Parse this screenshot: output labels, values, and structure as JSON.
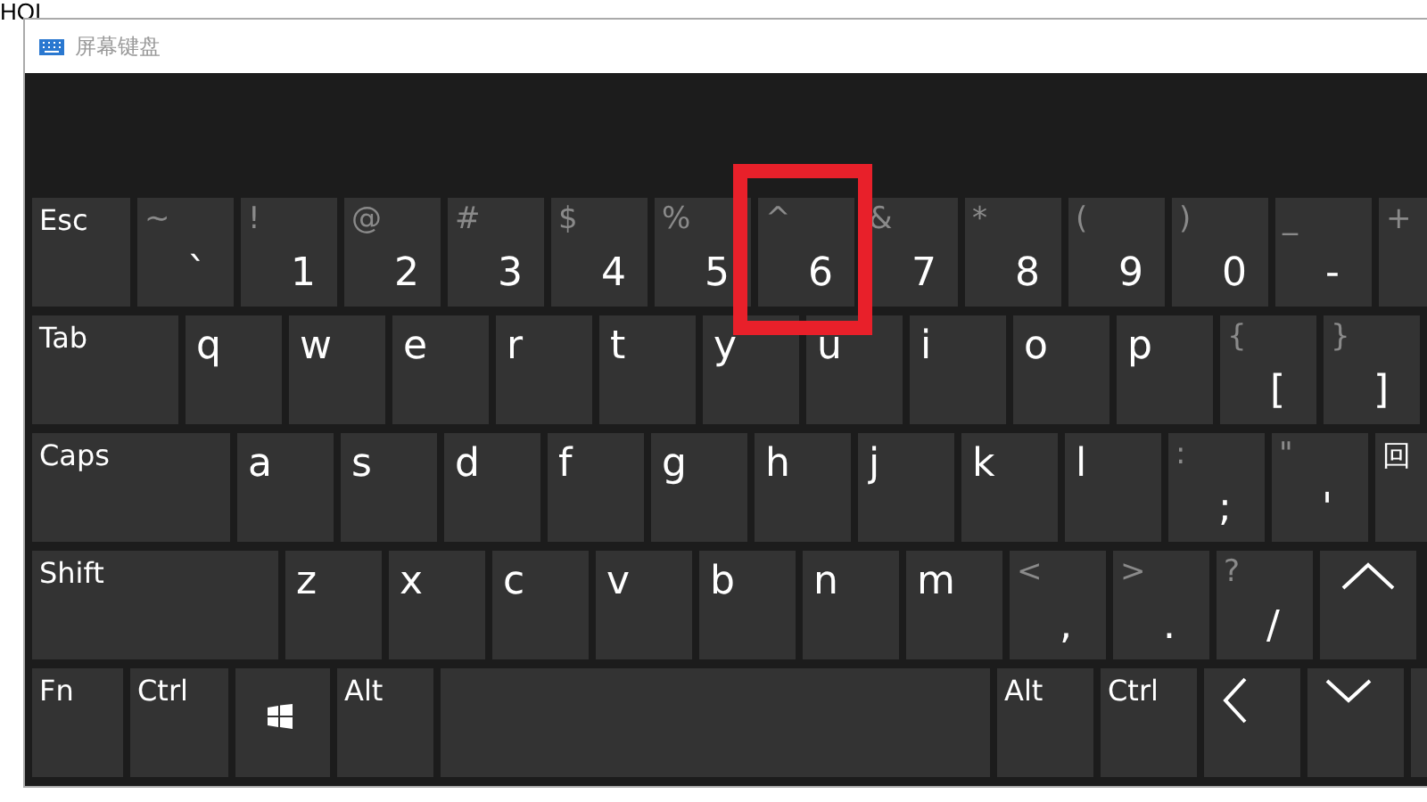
{
  "background_text": "HOI",
  "window": {
    "title": "屏幕键盘"
  },
  "rows": [
    {
      "keys": [
        {
          "kind": "mod",
          "label": "Esc",
          "highlighted": false
        },
        {
          "kind": "dual",
          "top": "~",
          "main": "`",
          "highlighted": false
        },
        {
          "kind": "dual",
          "top": "!",
          "main": "1",
          "highlighted": false
        },
        {
          "kind": "dual",
          "top": "@",
          "main": "2",
          "highlighted": false
        },
        {
          "kind": "dual",
          "top": "#",
          "main": "3",
          "highlighted": false
        },
        {
          "kind": "dual",
          "top": "$",
          "main": "4",
          "highlighted": false
        },
        {
          "kind": "dual",
          "top": "%",
          "main": "5",
          "highlighted": false
        },
        {
          "kind": "dual",
          "top": "^",
          "main": "6",
          "highlighted": true
        },
        {
          "kind": "dual",
          "top": "&",
          "main": "7",
          "highlighted": false
        },
        {
          "kind": "dual",
          "top": "*",
          "main": "8",
          "highlighted": false
        },
        {
          "kind": "dual",
          "top": "(",
          "main": "9",
          "highlighted": false
        },
        {
          "kind": "dual",
          "top": ")",
          "main": "0",
          "highlighted": false
        },
        {
          "kind": "dual",
          "top": "_",
          "main": "-",
          "highlighted": false
        },
        {
          "kind": "dual",
          "top": "+",
          "highlighted": false
        }
      ]
    },
    {
      "keys": [
        {
          "kind": "mod",
          "label": "Tab",
          "highlighted": false
        },
        {
          "kind": "char",
          "label": "q",
          "highlighted": false
        },
        {
          "kind": "char",
          "label": "w",
          "highlighted": false
        },
        {
          "kind": "char",
          "label": "e",
          "highlighted": false
        },
        {
          "kind": "char",
          "label": "r",
          "highlighted": false
        },
        {
          "kind": "char",
          "label": "t",
          "highlighted": false
        },
        {
          "kind": "char",
          "label": "y",
          "highlighted": false
        },
        {
          "kind": "char",
          "label": "u",
          "highlighted": false
        },
        {
          "kind": "char",
          "label": "i",
          "highlighted": false
        },
        {
          "kind": "char",
          "label": "o",
          "highlighted": false
        },
        {
          "kind": "char",
          "label": "p",
          "highlighted": false
        },
        {
          "kind": "dual",
          "top": "{",
          "main": "[",
          "highlighted": false
        },
        {
          "kind": "dual",
          "top": "}",
          "main": "]",
          "highlighted": false
        }
      ]
    },
    {
      "keys": [
        {
          "kind": "mod",
          "label": "Caps",
          "highlighted": false
        },
        {
          "kind": "char",
          "label": "a",
          "highlighted": false
        },
        {
          "kind": "char",
          "label": "s",
          "highlighted": false
        },
        {
          "kind": "char",
          "label": "d",
          "highlighted": false
        },
        {
          "kind": "char",
          "label": "f",
          "highlighted": false
        },
        {
          "kind": "char",
          "label": "g",
          "highlighted": false
        },
        {
          "kind": "char",
          "label": "h",
          "highlighted": false
        },
        {
          "kind": "char",
          "label": "j",
          "highlighted": false
        },
        {
          "kind": "char",
          "label": "k",
          "highlighted": false
        },
        {
          "kind": "char",
          "label": "l",
          "highlighted": false
        },
        {
          "kind": "dual",
          "top": ":",
          "main": ";",
          "highlighted": false
        },
        {
          "kind": "dual",
          "top": "\"",
          "main": "'",
          "highlighted": false
        },
        {
          "kind": "mod",
          "label": "回",
          "highlighted": false
        }
      ]
    },
    {
      "keys": [
        {
          "kind": "mod",
          "label": "Shift",
          "highlighted": false
        },
        {
          "kind": "char",
          "label": "z",
          "highlighted": false
        },
        {
          "kind": "char",
          "label": "x",
          "highlighted": false
        },
        {
          "kind": "char",
          "label": "c",
          "highlighted": false
        },
        {
          "kind": "char",
          "label": "v",
          "highlighted": false
        },
        {
          "kind": "char",
          "label": "b",
          "highlighted": false
        },
        {
          "kind": "char",
          "label": "n",
          "highlighted": false
        },
        {
          "kind": "char",
          "label": "m",
          "highlighted": false
        },
        {
          "kind": "dual",
          "top": "<",
          "main": ",",
          "highlighted": false
        },
        {
          "kind": "dual",
          "top": ">",
          "main": ".",
          "highlighted": false
        },
        {
          "kind": "dual",
          "top": "?",
          "main": "/",
          "highlighted": false
        },
        {
          "kind": "up",
          "highlighted": false
        }
      ]
    },
    {
      "keys": [
        {
          "kind": "mod",
          "label": "Fn",
          "highlighted": false
        },
        {
          "kind": "mod",
          "label": "Ctrl",
          "highlighted": false
        },
        {
          "kind": "win",
          "highlighted": false
        },
        {
          "kind": "mod",
          "label": "Alt",
          "highlighted": false
        },
        {
          "kind": "space",
          "highlighted": false
        },
        {
          "kind": "mod",
          "label": "Alt",
          "highlighted": false
        },
        {
          "kind": "mod",
          "label": "Ctrl",
          "highlighted": false
        },
        {
          "kind": "left",
          "highlighted": false
        },
        {
          "kind": "down",
          "highlighted": false
        },
        {
          "kind": "blank",
          "highlighted": false
        }
      ]
    }
  ]
}
